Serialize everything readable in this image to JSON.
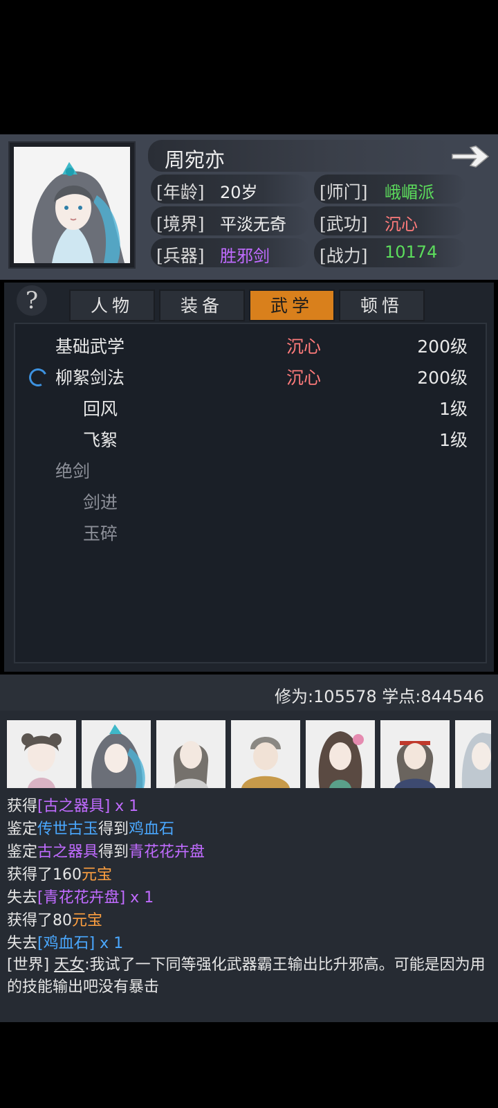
{
  "character": {
    "name": "周宛亦",
    "stats": {
      "age_label": "[年龄]",
      "age_value": "20岁",
      "sect_label": "[师门]",
      "sect_value": "峨嵋派",
      "realm_label": "[境界]",
      "realm_value": "平淡无奇",
      "martial_label": "[武功]",
      "martial_value": "沉心",
      "weapon_label": "[兵器]",
      "weapon_value": "胜邪剑",
      "power_label": "[战力]",
      "power_value": "10174"
    }
  },
  "help_symbol": "?",
  "tabs": [
    {
      "label": "人物",
      "active": false
    },
    {
      "label": "装备",
      "active": false
    },
    {
      "label": "武学",
      "active": true
    },
    {
      "label": "顿悟",
      "active": false
    }
  ],
  "skills": [
    {
      "name": "基础武学",
      "type": "沉心",
      "level": "200级"
    },
    {
      "name": "柳絮剑法",
      "type": "沉心",
      "level": "200级"
    },
    {
      "name": "回风",
      "type": "",
      "level": "1级"
    },
    {
      "name": "飞絮",
      "type": "",
      "level": "1级"
    },
    {
      "name": "绝剑",
      "type": "",
      "level": ""
    },
    {
      "name": "剑进",
      "type": "",
      "level": ""
    },
    {
      "name": "玉碎",
      "type": "",
      "level": ""
    }
  ],
  "footer": {
    "text": "修为:105578  学点:844546"
  },
  "log": {
    "lines": [
      {
        "a": "获得",
        "b": "[古之器具]",
        "c": " x 1",
        "d": "",
        "e": ""
      },
      {
        "a": "鉴定",
        "b": "传世古玉",
        "c": "得到",
        "d": "鸡血石",
        "e": ""
      },
      {
        "a": "鉴定",
        "b": "古之器具",
        "c": "得到",
        "d": "青花花卉盘",
        "e": ""
      },
      {
        "a": "获得了160",
        "b": "元宝",
        "c": "",
        "d": "",
        "e": ""
      },
      {
        "a": "失去",
        "b": "[青花花卉盘]",
        "c": " x 1",
        "d": "",
        "e": ""
      },
      {
        "a": "获得了80",
        "b": "元宝",
        "c": "",
        "d": "",
        "e": ""
      },
      {
        "a": "失去",
        "b": "[鸡血石]",
        "c": " x 1",
        "d": "",
        "e": ""
      }
    ],
    "chat": {
      "channel": "[世界]",
      "user": "天女",
      "message": ":我试了一下同等强化武器霸王输出比升邪高。可能是因为用的技能输出吧没有暴击"
    }
  }
}
